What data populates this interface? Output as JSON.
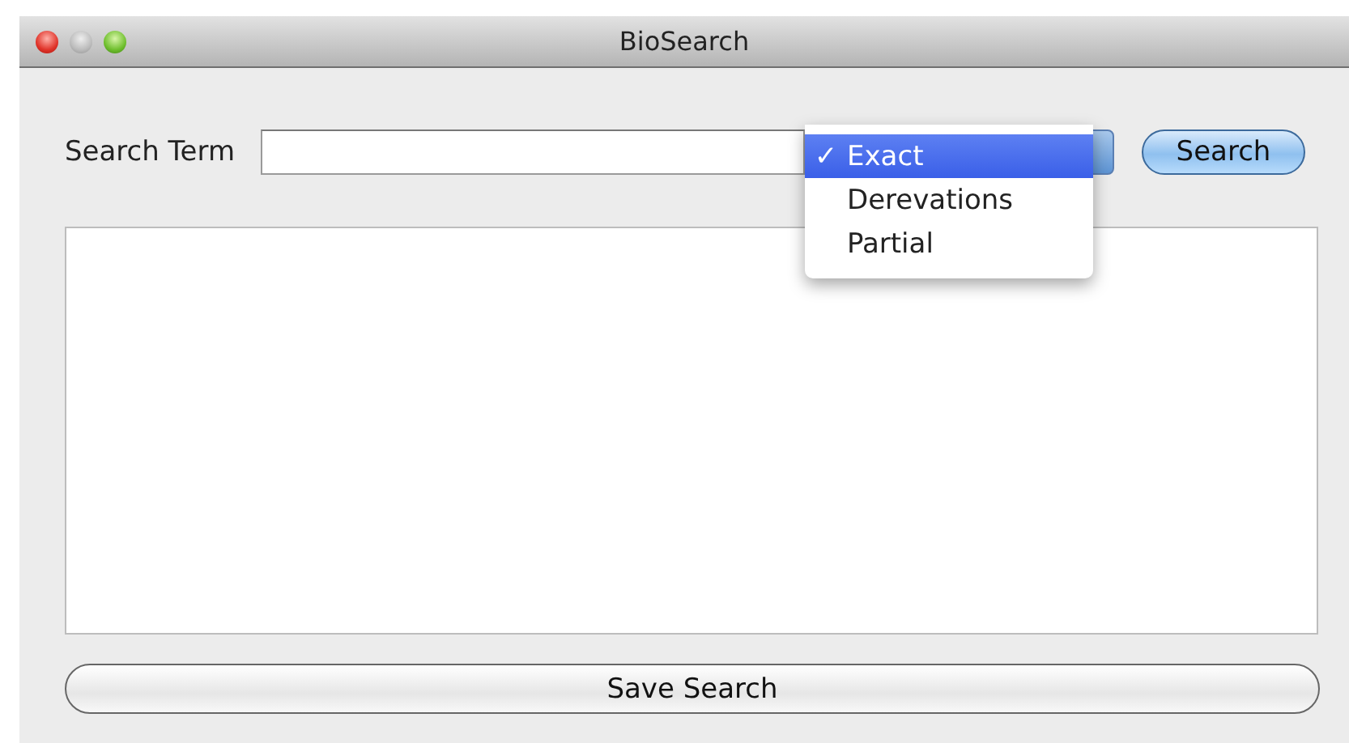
{
  "window": {
    "title": "BioSearch"
  },
  "search_label": "Search Term",
  "match_menu": {
    "items": [
      {
        "label": "Exact",
        "selected": true
      },
      {
        "label": "Derevations",
        "selected": false
      },
      {
        "label": "Partial",
        "selected": false
      }
    ],
    "check_mark": "✓"
  },
  "search_button": "Search",
  "save_button": "Save Search"
}
